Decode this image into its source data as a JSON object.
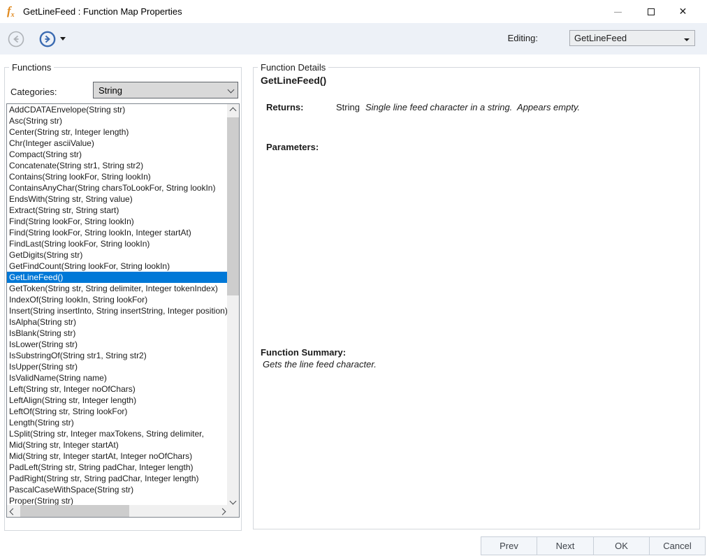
{
  "window": {
    "title": "GetLineFeed : Function Map Properties",
    "app_icon": "fx-function-icon"
  },
  "toolbar": {
    "back_icon": "back-circle-arrow",
    "forward_icon": "forward-circle-arrow",
    "editing_label": "Editing:",
    "editing_value": "GetLineFeed"
  },
  "functions_panel": {
    "legend": "Functions",
    "categories_label": "Categories:",
    "category_value": "String",
    "selected_index": 15,
    "items": [
      "AddCDATAEnvelope(String str)",
      "Asc(String str)",
      "Center(String str, Integer length)",
      "Chr(Integer asciiValue)",
      "Compact(String str)",
      "Concatenate(String str1, String str2)",
      "Contains(String lookFor, String lookIn)",
      "ContainsAnyChar(String charsToLookFor, String lookIn)",
      "EndsWith(String str, String value)",
      "Extract(String str, String start)",
      "Find(String lookFor, String lookIn)",
      "Find(String lookFor, String lookIn, Integer startAt)",
      "FindLast(String lookFor, String lookIn)",
      "GetDigits(String str)",
      "GetFindCount(String lookFor, String lookIn)",
      "GetLineFeed()",
      "GetToken(String str, String delimiter, Integer tokenIndex)",
      "IndexOf(String lookIn, String lookFor)",
      "Insert(String insertInto, String insertString, Integer position)",
      "IsAlpha(String str)",
      "IsBlank(String str)",
      "IsLower(String str)",
      "IsSubstringOf(String str1, String str2)",
      "IsUpper(String str)",
      "IsValidName(String name)",
      "Left(String str, Integer noOfChars)",
      "LeftAlign(String str, Integer length)",
      "LeftOf(String str, String lookFor)",
      "Length(String str)",
      "LSplit(String str, Integer maxTokens, String delimiter,",
      "Mid(String str, Integer startAt)",
      "Mid(String str, Integer startAt, Integer noOfChars)",
      "PadLeft(String str, String padChar, Integer length)",
      "PadRight(String str, String padChar, Integer length)",
      "PascalCaseWithSpace(String str)",
      "Proper(String str)"
    ]
  },
  "details_panel": {
    "legend": "Function Details",
    "heading": "GetLineFeed()",
    "returns_label": "Returns:",
    "returns_type": "String",
    "returns_desc": "Single line feed character in a string.  Appears empty.",
    "parameters_label": "Parameters:",
    "summary_label": "Function Summary:",
    "summary_text": "Gets the line feed character."
  },
  "footer": {
    "buttons": [
      "Prev",
      "Next",
      "OK",
      "Cancel"
    ]
  },
  "colors": {
    "selection_blue": "#0078d7",
    "icon_orange": "#e0891e",
    "forward_blue": "#3a6ab1",
    "toolbar_bg": "#edf1f7"
  }
}
